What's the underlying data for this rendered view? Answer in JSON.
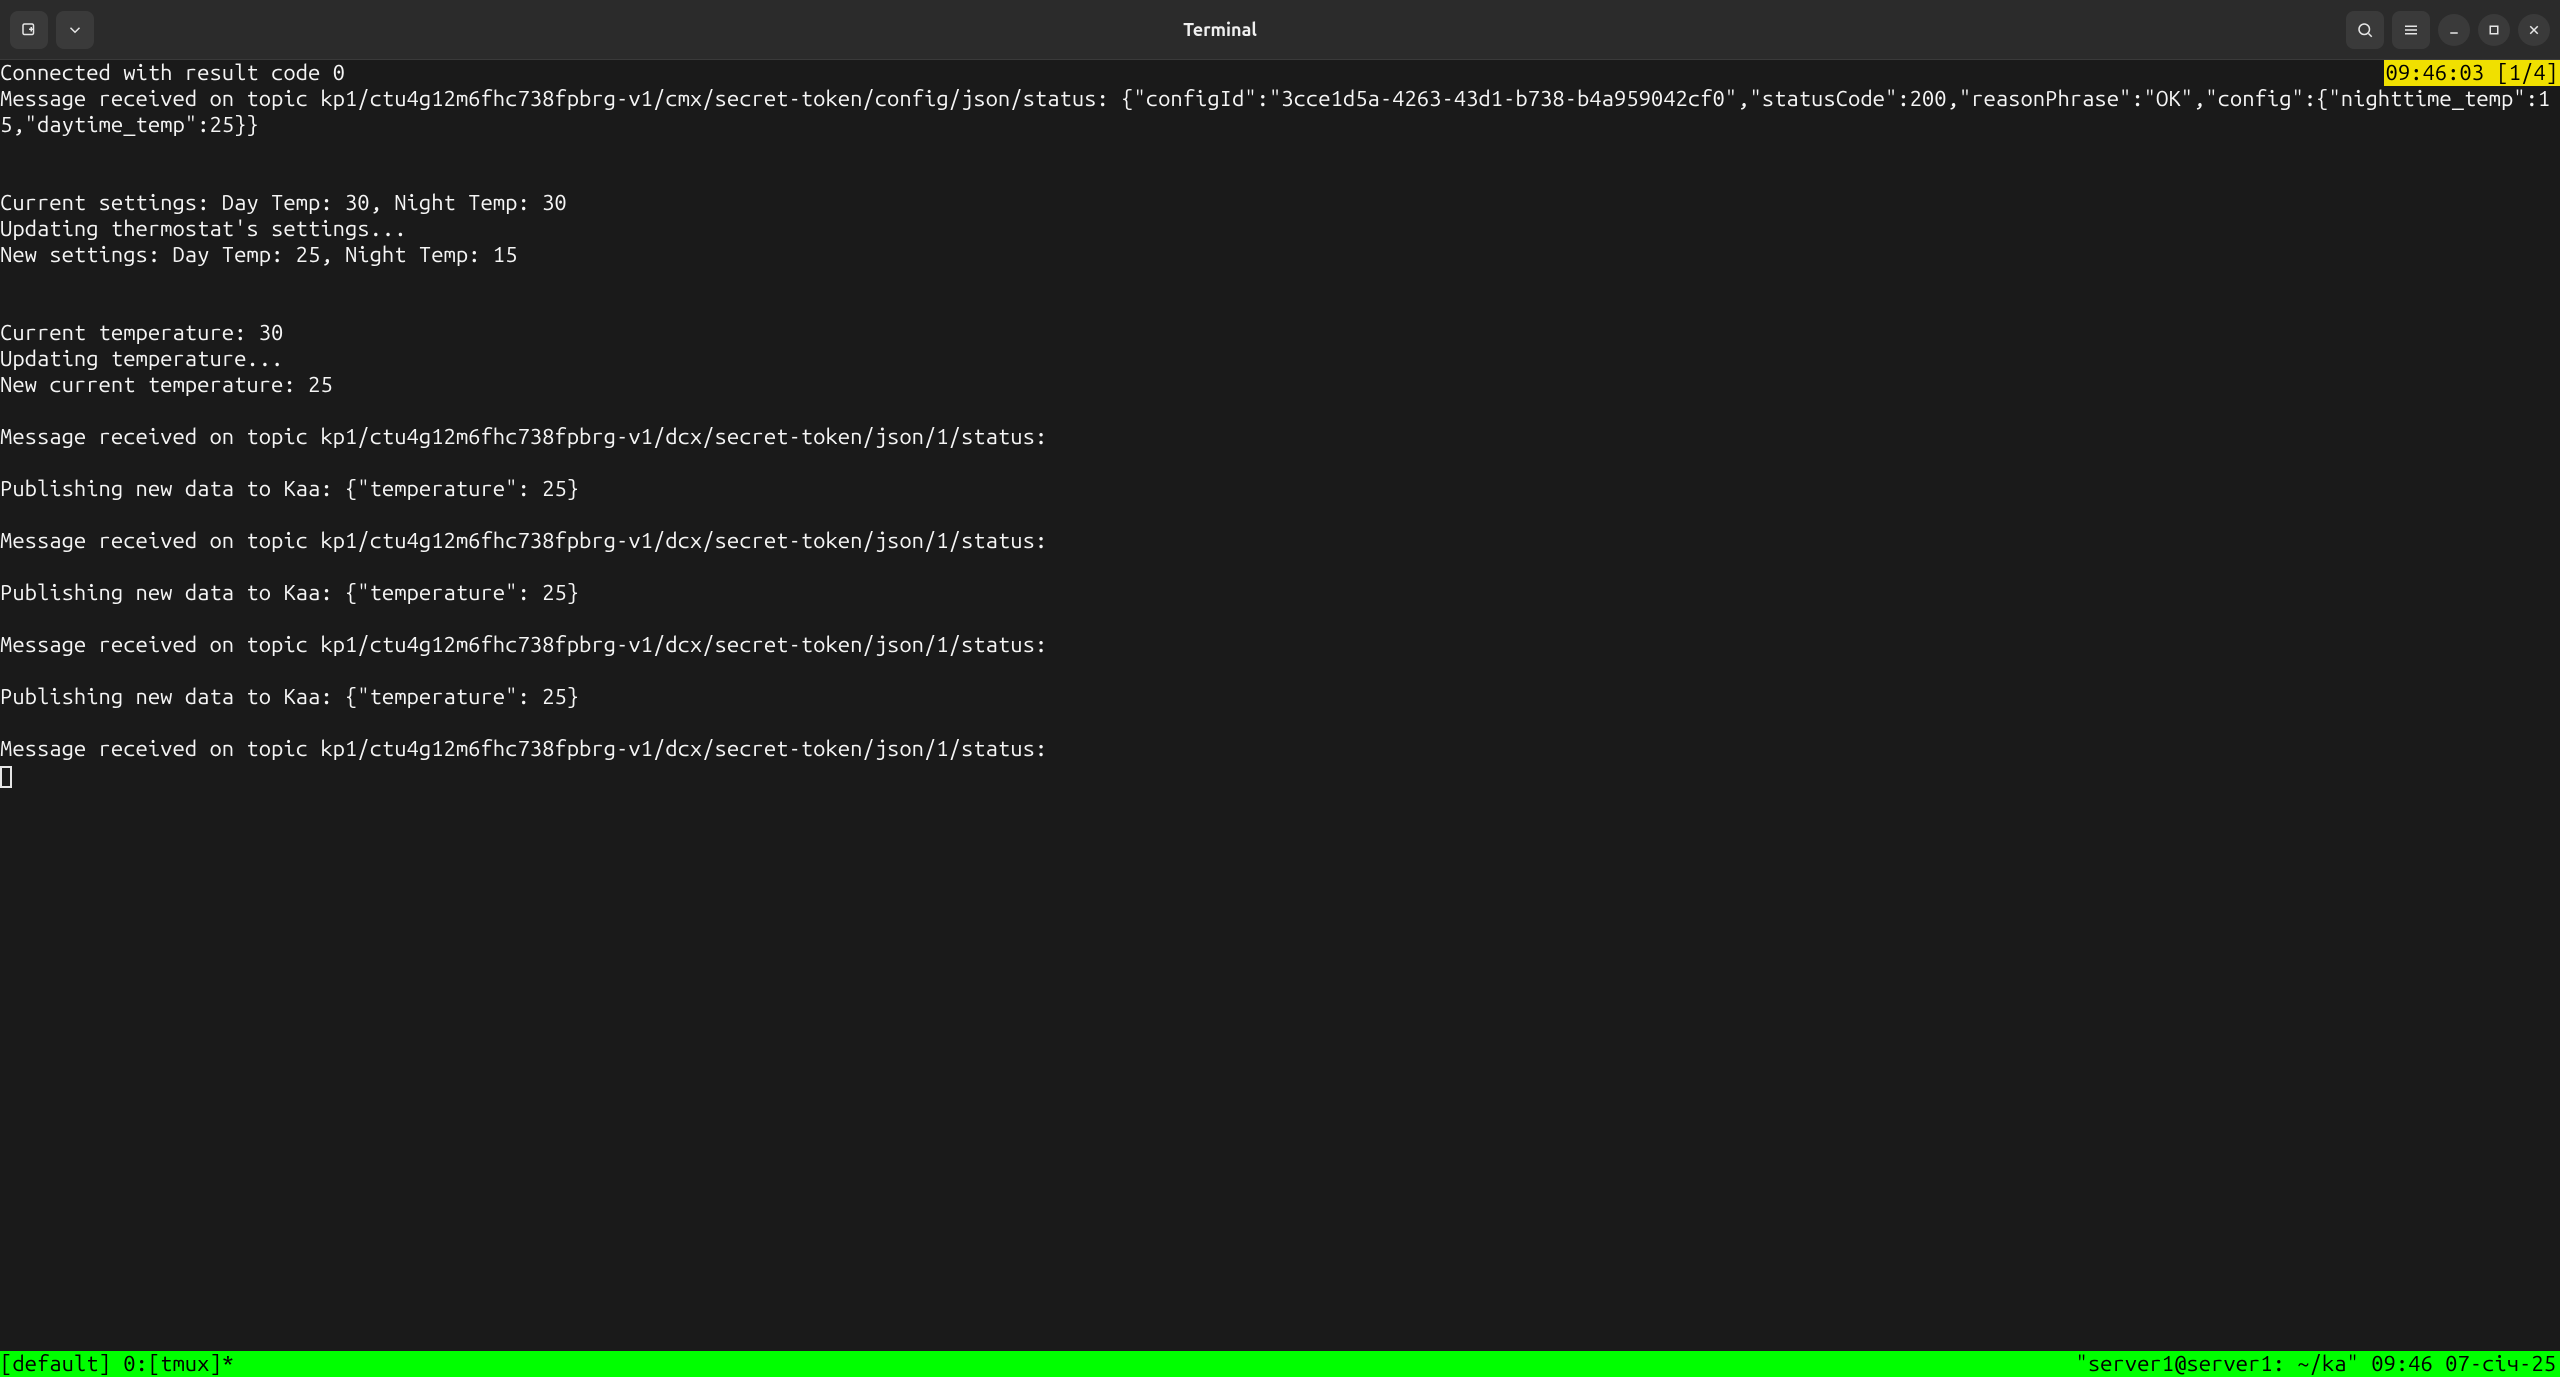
{
  "header": {
    "title": "Terminal"
  },
  "badge": {
    "text": "09:46:03 [1/4]"
  },
  "lines": [
    "Connected with result code 0",
    "Message received on topic kp1/ctu4g12m6fhc738fpbrg-v1/cmx/secret-token/config/json/status: {\"configId\":\"3cce1d5a-4263-43d1-b738-b4a959042cf0\",\"statusCode\":200,\"reasonPhrase\":\"OK\",\"config\":{\"nighttime_temp\":15,\"daytime_temp\":25}}",
    "",
    "",
    "Current settings: Day Temp: 30, Night Temp: 30",
    "Updating thermostat's settings...",
    "New settings: Day Temp: 25, Night Temp: 15",
    "",
    "",
    "Current temperature: 30",
    "Updating temperature...",
    "New current temperature: 25",
    "",
    "Message received on topic kp1/ctu4g12m6fhc738fpbrg-v1/dcx/secret-token/json/1/status:",
    "",
    "Publishing new data to Kaa: {\"temperature\": 25}",
    "",
    "Message received on topic kp1/ctu4g12m6fhc738fpbrg-v1/dcx/secret-token/json/1/status:",
    "",
    "Publishing new data to Kaa: {\"temperature\": 25}",
    "",
    "Message received on topic kp1/ctu4g12m6fhc738fpbrg-v1/dcx/secret-token/json/1/status:",
    "",
    "Publishing new data to Kaa: {\"temperature\": 25}",
    "",
    "Message received on topic kp1/ctu4g12m6fhc738fpbrg-v1/dcx/secret-token/json/1/status:"
  ],
  "tmux": {
    "left": "[default] 0:[tmux]*",
    "right": "\"server1@server1: ~/ka\" 09:46 07-січ-25"
  }
}
